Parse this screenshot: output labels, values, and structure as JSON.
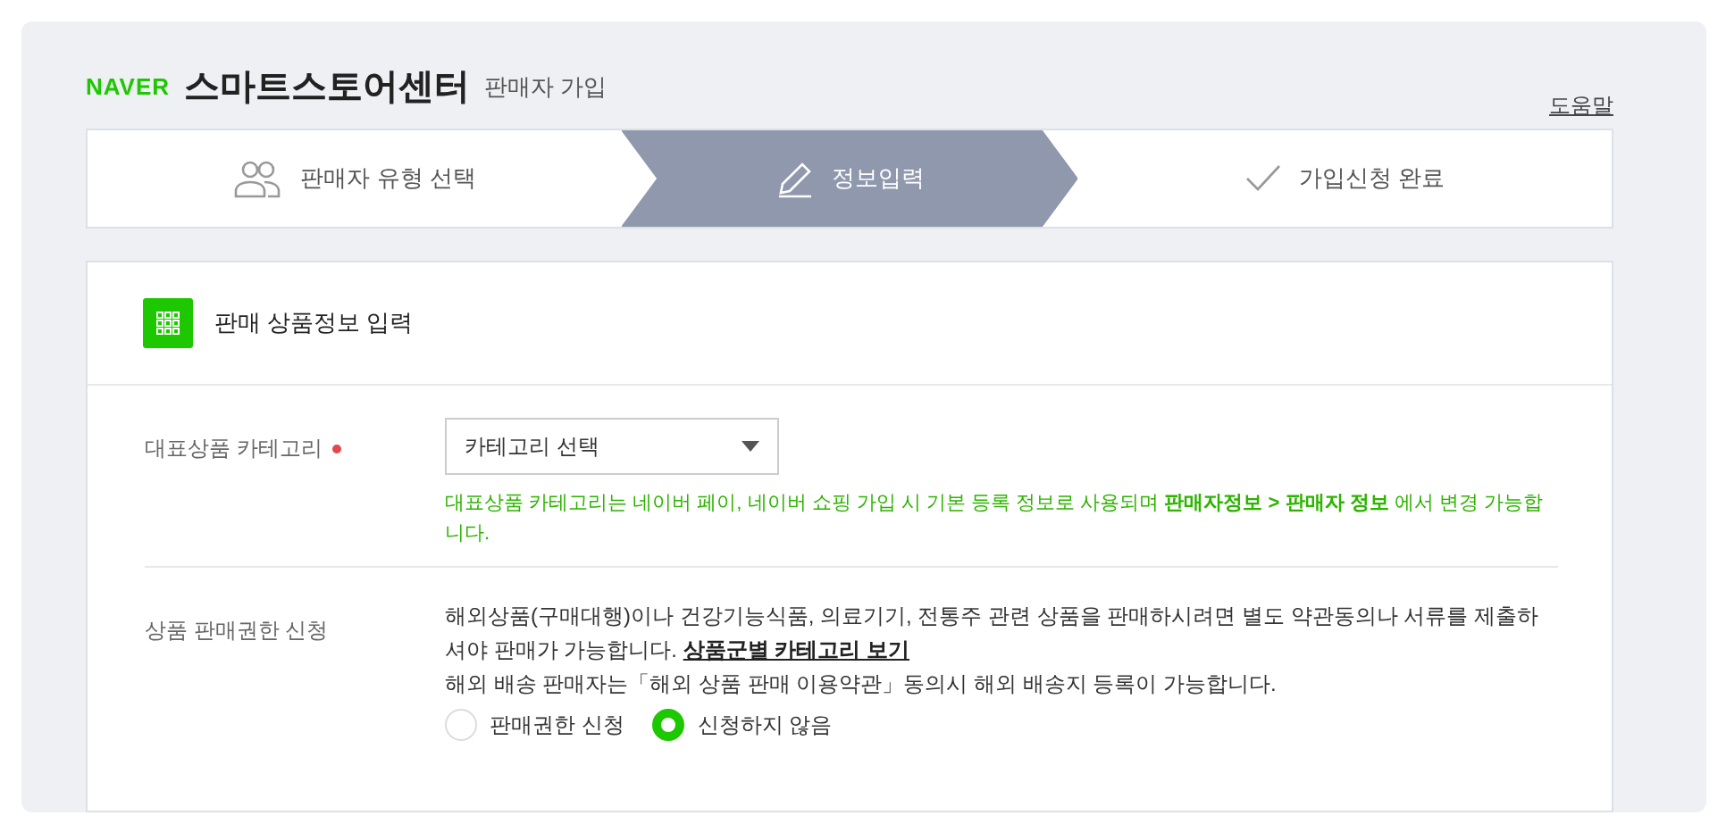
{
  "header": {
    "brand": "NAVER",
    "title": "스마트스토어센터",
    "subtitle": "판매자 가입",
    "help": "도움말"
  },
  "steps": [
    {
      "label": "판매자 유형 선택",
      "kind": "people",
      "selected": false
    },
    {
      "label": "정보입력",
      "kind": "pencil",
      "selected": true
    },
    {
      "label": "가입신청 완료",
      "kind": "check",
      "selected": false
    }
  ],
  "section": {
    "title": "판매 상품정보 입력"
  },
  "category": {
    "label": "대표상품 카테고리",
    "required": true,
    "select": "카테고리 선택",
    "hint": "대표상품 카테고리는 네이버 페이, 네이버 쇼핑 가입 시 기본 등록 정보로 사용되며 **판매자정보 > 판매자 정보** 에서 변경 가능합니다."
  },
  "permission": {
    "label": "상품 판매권한 신청",
    "description": "해외상품(구매대행)이나 건강기능식품, 의료기기, 전통주 관련 상품을 판매하시려면 별도 약관동의나 서류를 제출하셔야 판매가 가능합니다.",
    "link": "상품군별 카테고리 보기",
    "note": "해외 배송 판매자는「해외 상품 판매 이용약관」동의시 해외 배송지 등록이 가능합니다.",
    "options": [
      {
        "label": "판매권한 신청",
        "selected": false
      },
      {
        "label": "신청하지 않음",
        "selected": true
      }
    ]
  }
}
